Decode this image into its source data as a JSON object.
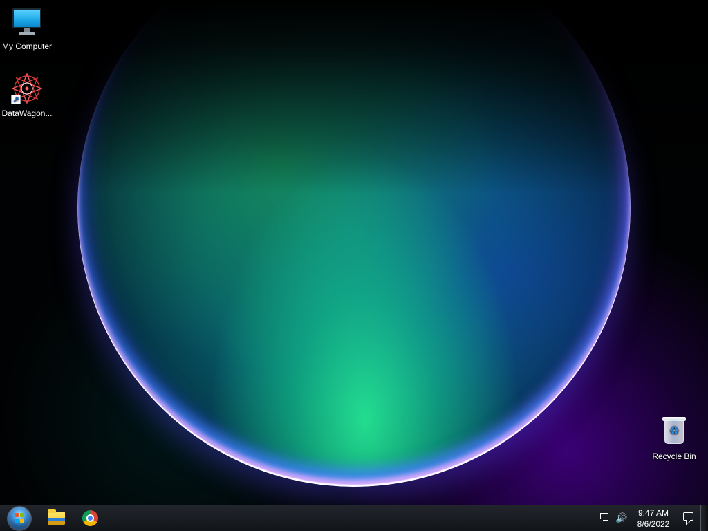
{
  "desktop": {
    "icons": [
      {
        "label": "My Computer",
        "icon": "computer-icon"
      },
      {
        "label": "DataWagon...",
        "icon": "datawagon-shortcut-icon"
      },
      {
        "label": "Recycle Bin",
        "icon": "recycle-bin-icon"
      }
    ]
  },
  "taskbar": {
    "start_icon": "windows-start-icon",
    "pinned_apps": [
      {
        "icon": "file-explorer-icon"
      },
      {
        "icon": "chrome-icon"
      }
    ],
    "tray": {
      "network_icon": "network-icon",
      "volume_icon": "volume-icon",
      "volume_glyph": "🔊",
      "time": "9:47 AM",
      "date": "8/6/2022",
      "notification_icon": "notification-icon"
    }
  },
  "colors": {
    "taskbar": "#15191e",
    "accent_blue": "#2490ea",
    "orb_green": "#28f596",
    "orb_purple": "#6900d2"
  }
}
